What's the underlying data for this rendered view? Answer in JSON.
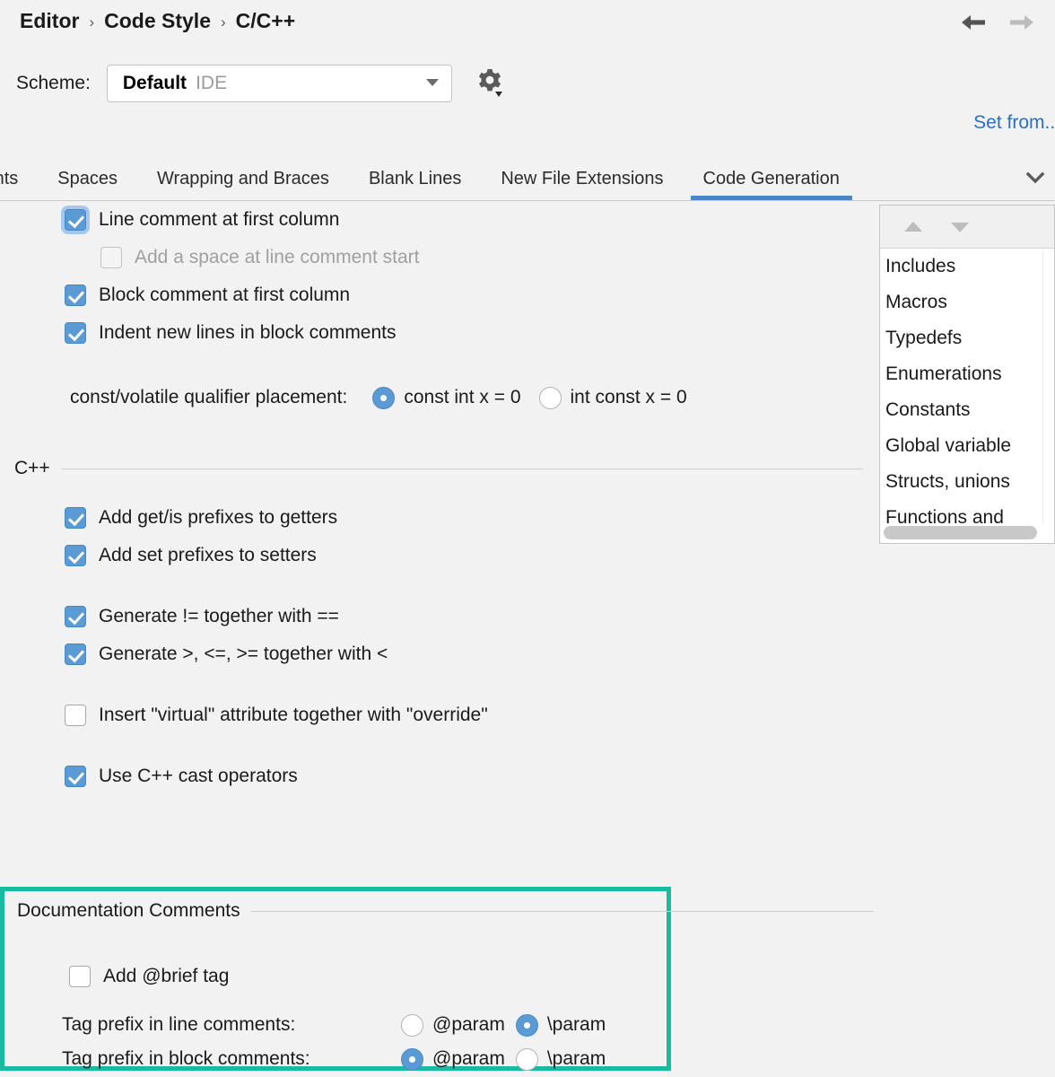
{
  "header": {
    "breadcrumb": [
      "Editor",
      "Code Style",
      "C/C++"
    ],
    "separator": "›",
    "back_icon": "arrow-left-icon",
    "forward_icon": "arrow-right-icon",
    "set_from_link": "Set from..."
  },
  "scheme": {
    "label": "Scheme:",
    "value": "Default",
    "value_suffix": "IDE",
    "gear_icon": "gear-icon"
  },
  "tabs": [
    {
      "label": "lents",
      "active": false
    },
    {
      "label": "Spaces",
      "active": false
    },
    {
      "label": "Wrapping and Braces",
      "active": false
    },
    {
      "label": "Blank Lines",
      "active": false
    },
    {
      "label": "New File Extensions",
      "active": false
    },
    {
      "label": "Code Generation",
      "active": true
    }
  ],
  "tab_overflow_icon": "chevron-down-icon",
  "comments": {
    "line_comment_first_column": {
      "label": "Line comment at first column",
      "checked": true,
      "focused": true
    },
    "add_space_line_comment": {
      "label": "Add a space at line comment start",
      "checked": false,
      "disabled": true
    },
    "block_comment_first_column": {
      "label": "Block comment at first column",
      "checked": true
    },
    "indent_block_comments": {
      "label": "Indent new lines in block comments",
      "checked": true
    }
  },
  "qualifier": {
    "label": "const/volatile qualifier placement:",
    "options": [
      {
        "label": "const int x = 0",
        "selected": true
      },
      {
        "label": "int const x = 0",
        "selected": false
      }
    ]
  },
  "cpp_section": {
    "title": "C++",
    "items": [
      {
        "label": "Add get/is prefixes to getters",
        "checked": true,
        "gap_after": false
      },
      {
        "label": "Add set prefixes to setters",
        "checked": true,
        "gap_after": true
      },
      {
        "label": "Generate != together with ==",
        "checked": true,
        "gap_after": false
      },
      {
        "label": "Generate >, <=, >= together with <",
        "checked": true,
        "gap_after": true
      },
      {
        "label": "Insert \"virtual\" attribute together with \"override\"",
        "checked": false,
        "gap_after": true
      },
      {
        "label": "Use C++ cast operators",
        "checked": true,
        "gap_after": false
      }
    ]
  },
  "documentation": {
    "title": "Documentation Comments",
    "highlight_color": "#18bba0",
    "add_brief": {
      "label": "Add @brief tag",
      "checked": false
    },
    "line_prefix": {
      "label": "Tag prefix in line comments:",
      "options": [
        {
          "label": "@param",
          "selected": false
        },
        {
          "label": "\\param",
          "selected": true
        }
      ]
    },
    "block_prefix": {
      "label": "Tag prefix in block comments:",
      "options": [
        {
          "label": "@param",
          "selected": true
        },
        {
          "label": "\\param",
          "selected": false
        }
      ]
    }
  },
  "list_panel": {
    "move_up_icon": "triangle-up-icon",
    "move_down_icon": "triangle-down-icon",
    "items": [
      "Includes",
      "Macros",
      "Typedefs",
      "Enumerations",
      "Constants",
      "Global variable",
      "Structs, unions",
      "Functions and"
    ]
  }
}
